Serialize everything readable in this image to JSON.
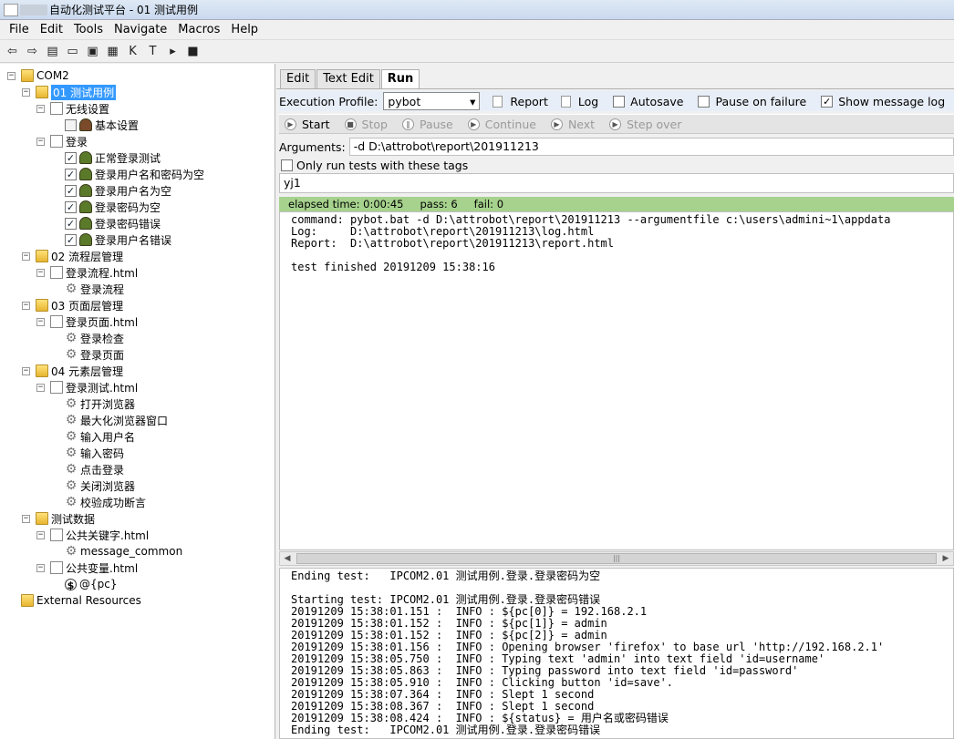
{
  "window": {
    "title": "自动化测试平台 - 01 测试用例"
  },
  "menubar": [
    "File",
    "Edit",
    "Tools",
    "Navigate",
    "Macros",
    "Help"
  ],
  "toolbar": [
    {
      "name": "back-icon",
      "glyph": "⇦"
    },
    {
      "name": "forward-icon",
      "glyph": "⇨"
    },
    {
      "name": "open-project-icon",
      "glyph": "▤"
    },
    {
      "name": "open-folder-icon",
      "glyph": "▭"
    },
    {
      "name": "save-icon",
      "glyph": "▣"
    },
    {
      "name": "save-all-icon",
      "glyph": "▦"
    },
    {
      "name": "keyword-search-icon",
      "glyph": "K"
    },
    {
      "name": "text-search-icon",
      "glyph": "T"
    },
    {
      "name": "run-icon",
      "glyph": "▸"
    },
    {
      "name": "stop-icon",
      "glyph": "■"
    }
  ],
  "tree": [
    {
      "text": "COM2",
      "icon": "folder",
      "exp": "−"
    },
    {
      "text": "01 测试用例",
      "icon": "folder",
      "exp": "−",
      "selected": true
    },
    {
      "text": "无线设置",
      "icon": "file",
      "exp": "−"
    },
    {
      "text": "基本设置",
      "icon": "robot-red",
      "check": false
    },
    {
      "text": "登录",
      "icon": "file",
      "exp": "−"
    },
    {
      "text": "正常登录测试",
      "icon": "robot",
      "check": true
    },
    {
      "text": "登录用户名和密码为空",
      "icon": "robot",
      "check": true
    },
    {
      "text": "登录用户名为空",
      "icon": "robot",
      "check": true
    },
    {
      "text": "登录密码为空",
      "icon": "robot",
      "check": true
    },
    {
      "text": "登录密码错误",
      "icon": "robot",
      "check": true
    },
    {
      "text": "登录用户名错误",
      "icon": "robot",
      "check": true
    },
    {
      "text": "02 流程层管理",
      "icon": "folder",
      "exp": "−"
    },
    {
      "text": "登录流程.html",
      "icon": "file",
      "exp": "−"
    },
    {
      "text": "登录流程",
      "icon": "gear"
    },
    {
      "text": "03 页面层管理",
      "icon": "folder",
      "exp": "−"
    },
    {
      "text": "登录页面.html",
      "icon": "file",
      "exp": "−"
    },
    {
      "text": "登录检查",
      "icon": "gear"
    },
    {
      "text": "登录页面",
      "icon": "gear"
    },
    {
      "text": "04 元素层管理",
      "icon": "folder",
      "exp": "−"
    },
    {
      "text": "登录测试.html",
      "icon": "file",
      "exp": "−"
    },
    {
      "text": "打开浏览器",
      "icon": "gear"
    },
    {
      "text": "最大化浏览器窗口",
      "icon": "gear"
    },
    {
      "text": "输入用户名",
      "icon": "gear"
    },
    {
      "text": "输入密码",
      "icon": "gear"
    },
    {
      "text": "点击登录",
      "icon": "gear"
    },
    {
      "text": "关闭浏览器",
      "icon": "gear"
    },
    {
      "text": "校验成功断言",
      "icon": "gear"
    },
    {
      "text": "测试数据",
      "icon": "folder",
      "exp": "−"
    },
    {
      "text": "公共关键字.html",
      "icon": "file",
      "exp": "−"
    },
    {
      "text": "message_common",
      "icon": "gear"
    },
    {
      "text": "公共变量.html",
      "icon": "file",
      "exp": "−"
    },
    {
      "text": "@{pc}",
      "icon": "var"
    },
    {
      "text": "External Resources",
      "icon": "folder"
    }
  ],
  "tabs": [
    "Edit",
    "Text Edit",
    "Run"
  ],
  "exec": {
    "label": "Execution Profile:",
    "profile": "pybot",
    "report": "Report",
    "log": "Log",
    "autosave": "Autosave",
    "pause": "Pause on failure",
    "show_log": "Show message log"
  },
  "run_buttons": [
    {
      "label": "Start",
      "glyph": "▶"
    },
    {
      "label": "Stop",
      "glyph": "■"
    },
    {
      "label": "Pause",
      "glyph": "‖"
    },
    {
      "label": "Continue",
      "glyph": "▶"
    },
    {
      "label": "Next",
      "glyph": "▶"
    },
    {
      "label": "Step over",
      "glyph": "▶"
    }
  ],
  "args": {
    "label": "Arguments:",
    "value": "-d D:\\attrobot\\report\\201911213"
  },
  "tags": {
    "label": "Only run tests with these tags",
    "value": "yj1"
  },
  "status": {
    "elapsed": "elapsed time: 0:00:45",
    "pass": "pass: 6",
    "fail": "fail: 0"
  },
  "output": [
    "command: pybot.bat -d D:\\attrobot\\report\\201911213 --argumentfile c:\\users\\admini~1\\appdata",
    "Log:     D:\\attrobot\\report\\201911213\\log.html",
    "Report:  D:\\attrobot\\report\\201911213\\report.html",
    "",
    "test finished 20191209 15:38:16"
  ],
  "log": [
    "Ending test:   IPCOM2.01 测试用例.登录.登录密码为空",
    "",
    "Starting test: IPCOM2.01 测试用例.登录.登录密码错误",
    "20191209 15:38:01.151 :  INFO : ${pc[0]} = 192.168.2.1",
    "20191209 15:38:01.152 :  INFO : ${pc[1]} = admin",
    "20191209 15:38:01.152 :  INFO : ${pc[2]} = admin",
    "20191209 15:38:01.156 :  INFO : Opening browser 'firefox' to base url 'http://192.168.2.1'",
    "20191209 15:38:05.750 :  INFO : Typing text 'admin' into text field 'id=username'",
    "20191209 15:38:05.863 :  INFO : Typing password into text field 'id=password'",
    "20191209 15:38:05.910 :  INFO : Clicking button 'id=save'.",
    "20191209 15:38:07.364 :  INFO : Slept 1 second",
    "20191209 15:38:08.367 :  INFO : Slept 1 second",
    "20191209 15:38:08.424 :  INFO : ${status} = 用户名或密码错误",
    "Ending test:   IPCOM2.01 测试用例.登录.登录密码错误"
  ]
}
